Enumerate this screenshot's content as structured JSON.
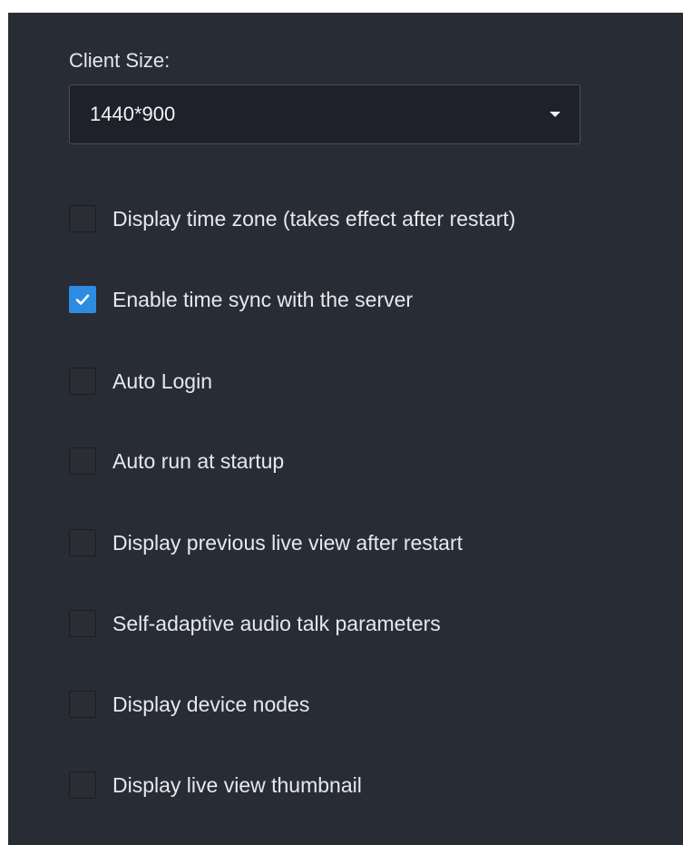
{
  "client_size": {
    "label": "Client Size:",
    "value": "1440*900"
  },
  "options": [
    {
      "label": "Display time zone (takes effect after restart)",
      "checked": false
    },
    {
      "label": "Enable time sync with the server",
      "checked": true
    },
    {
      "label": "Auto Login",
      "checked": false
    },
    {
      "label": "Auto run at startup",
      "checked": false
    },
    {
      "label": "Display previous live view after restart",
      "checked": false
    },
    {
      "label": "Self-adaptive audio talk parameters",
      "checked": false
    },
    {
      "label": "Display device nodes",
      "checked": false
    },
    {
      "label": "Display live view thumbnail",
      "checked": false
    }
  ],
  "colors": {
    "panel_background": "#282c35",
    "checkbox_checked": "#2d8ce2"
  }
}
